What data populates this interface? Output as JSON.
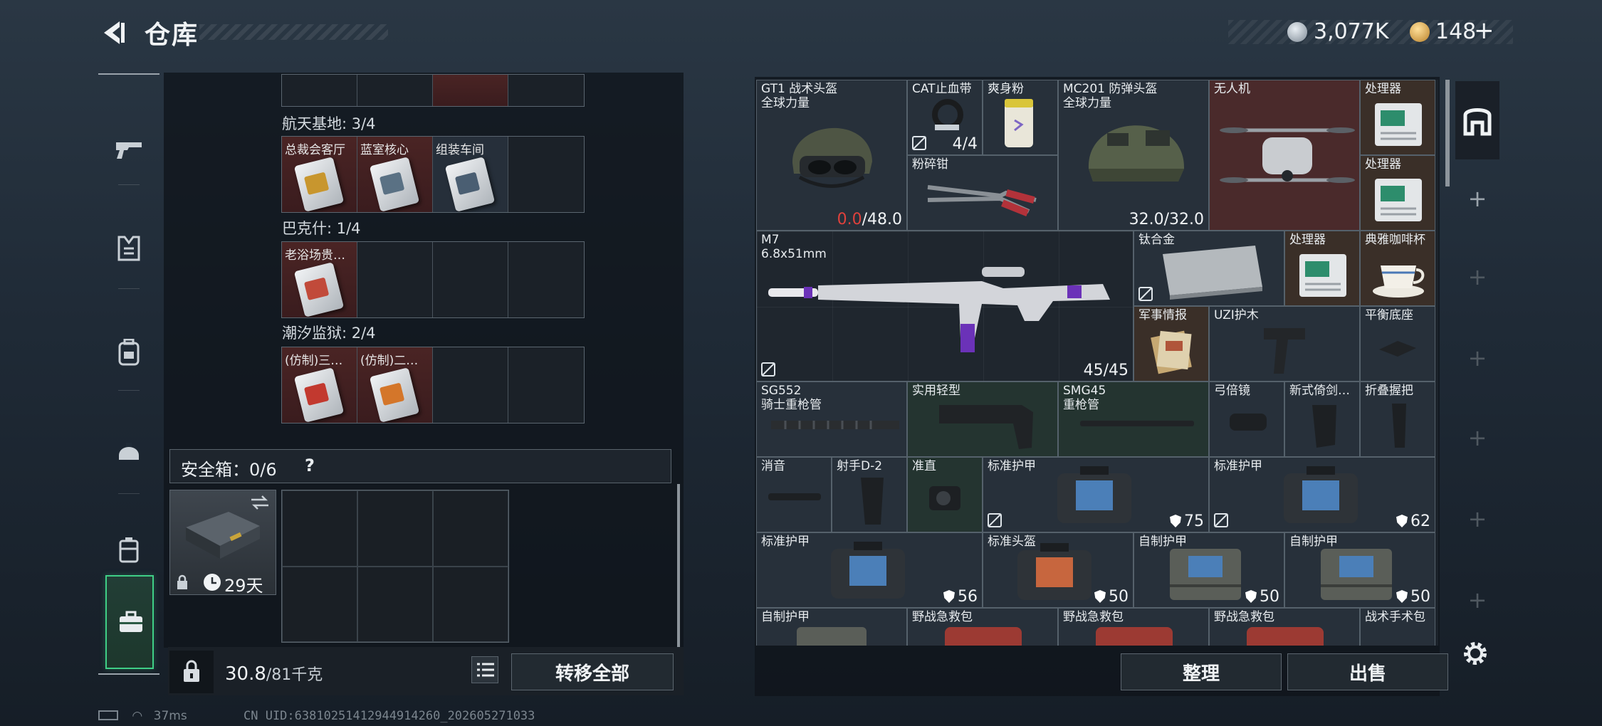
{
  "header": {
    "title": "仓库"
  },
  "currency": {
    "silver": "3,077K",
    "gold": "148",
    "gold_add": "+"
  },
  "nav": {
    "items": [
      "weapon-icon",
      "armor-vest-icon",
      "backpack-icon",
      "helmet-icon",
      "chest-rig-icon",
      "briefcase-icon"
    ]
  },
  "left": {
    "groups": [
      {
        "label": "航天基地: 3/4",
        "slots": [
          "总裁会客厅",
          "蓝室核心",
          "组装车间",
          ""
        ]
      },
      {
        "label": "巴克什: 1/4",
        "slots": [
          "老浴场贵…",
          "",
          "",
          ""
        ]
      },
      {
        "label": "潮汐监狱: 2/4",
        "slots": [
          "(仿制)三…",
          "(仿制)二…",
          "",
          ""
        ]
      }
    ],
    "safe_label": "安全箱：0/6",
    "safe_help": "?",
    "case_days": "29天",
    "weight": "30.8",
    "weight_max": "/81千克",
    "transfer_all": "转移全部"
  },
  "items": {
    "gt1": {
      "name": "GT1 战术头盔",
      "sub": "全球力量",
      "dur_low": "0.0",
      "dur_max": "/48.0"
    },
    "cat": {
      "name": "CAT止血带",
      "count": "4/4"
    },
    "smell": {
      "name": "爽身粉"
    },
    "crusher": {
      "name": "粉碎钳"
    },
    "mc201": {
      "name": "MC201 防弹头盔",
      "sub": "全球力量",
      "dur": "32.0/32.0"
    },
    "drone": {
      "name": "无人机"
    },
    "proc1": {
      "name": "处理器"
    },
    "proc2": {
      "name": "处理器"
    },
    "m7": {
      "name": "M7",
      "sub": "6.8x51mm",
      "ammo": "45/45"
    },
    "titanium": {
      "name": "钛合金"
    },
    "proc3": {
      "name": "处理器"
    },
    "cup": {
      "name": "典雅咖啡杯"
    },
    "intel": {
      "name": "军事情报"
    },
    "uzi": {
      "name": "UZI护木"
    },
    "balance": {
      "name": "平衡底座"
    },
    "sg552": {
      "name": "SG552",
      "sub": "骑士重枪管"
    },
    "stock": {
      "name": "实用轻型"
    },
    "smg45": {
      "name": "SMG45",
      "sub": "重枪管"
    },
    "bowscope": {
      "name": "弓倍镜"
    },
    "grip_new": {
      "name": "新式倚剑…"
    },
    "grip_fold": {
      "name": "折叠握把"
    },
    "silencer": {
      "name": "消音"
    },
    "shooter": {
      "name": "射手D-2"
    },
    "sight": {
      "name": "准直"
    },
    "armor1": {
      "name": "标准护甲",
      "value": "75"
    },
    "armor2": {
      "name": "标准护甲",
      "value": "62"
    },
    "armor3": {
      "name": "标准护甲",
      "value": "56"
    },
    "helm_std": {
      "name": "标准头盔",
      "value": "50"
    },
    "self1": {
      "name": "自制护甲",
      "value": "50"
    },
    "self2": {
      "name": "自制护甲",
      "value": "50"
    },
    "self3": {
      "name": "自制护甲"
    },
    "med1": {
      "name": "野战急救包"
    },
    "med2": {
      "name": "野战急救包"
    },
    "med3": {
      "name": "野战急救包"
    },
    "surgery": {
      "name": "战术手术包"
    }
  },
  "actions": {
    "tidy": "整理",
    "sell": "出售"
  },
  "footer": {
    "ping": "37ms",
    "uid": "CN UID:638102514129449142​60_202605271033"
  },
  "colors": {
    "accent_green": "#3fcf86",
    "durability_low": "#e0413c"
  }
}
